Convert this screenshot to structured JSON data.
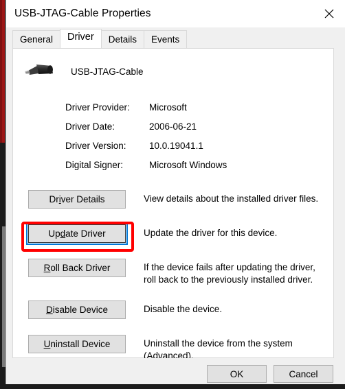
{
  "window": {
    "title": "USB-JTAG-Cable Properties",
    "close_icon": "close-icon"
  },
  "tabs": [
    {
      "label": "General",
      "active": false
    },
    {
      "label": "Driver",
      "active": true
    },
    {
      "label": "Details",
      "active": false
    },
    {
      "label": "Events",
      "active": false
    }
  ],
  "device": {
    "name": "USB-JTAG-Cable",
    "icon": "usb-plug-icon"
  },
  "driver_info": [
    {
      "label": "Driver Provider:",
      "value": "Microsoft"
    },
    {
      "label": "Driver Date:",
      "value": "2006-06-21"
    },
    {
      "label": "Driver Version:",
      "value": "10.0.19041.1"
    },
    {
      "label": "Digital Signer:",
      "value": "Microsoft Windows"
    }
  ],
  "actions": [
    {
      "label": "Driver Details",
      "accel_prefix": "Dr",
      "accel_char": "i",
      "accel_suffix": "ver Details",
      "description": "View details about the installed driver files.",
      "focused": false,
      "highlighted": false
    },
    {
      "label": "Update Driver",
      "accel_prefix": "Up",
      "accel_char": "d",
      "accel_suffix": "ate Driver",
      "description": "Update the driver for this device.",
      "focused": true,
      "highlighted": true
    },
    {
      "label": "Roll Back Driver",
      "accel_prefix": "",
      "accel_char": "R",
      "accel_suffix": "oll Back Driver",
      "description": "If the device fails after updating the driver, roll back to the previously installed driver.",
      "focused": false,
      "highlighted": false
    },
    {
      "label": "Disable Device",
      "accel_prefix": "",
      "accel_char": "D",
      "accel_suffix": "isable Device",
      "description": "Disable the device.",
      "focused": false,
      "highlighted": false
    },
    {
      "label": "Uninstall Device",
      "accel_prefix": "",
      "accel_char": "U",
      "accel_suffix": "ninstall Device",
      "description": "Uninstall the device from the system (Advanced).",
      "focused": false,
      "highlighted": false
    }
  ],
  "footer": {
    "ok_label": "OK",
    "cancel_label": "Cancel"
  },
  "colors": {
    "highlight_red": "#ff0000",
    "focus_blue": "#0078d7",
    "dialog_bg": "#f0f0f0",
    "panel_bg": "#ffffff",
    "button_bg": "#e1e1e1",
    "backdrop_red": "#9c1616"
  }
}
